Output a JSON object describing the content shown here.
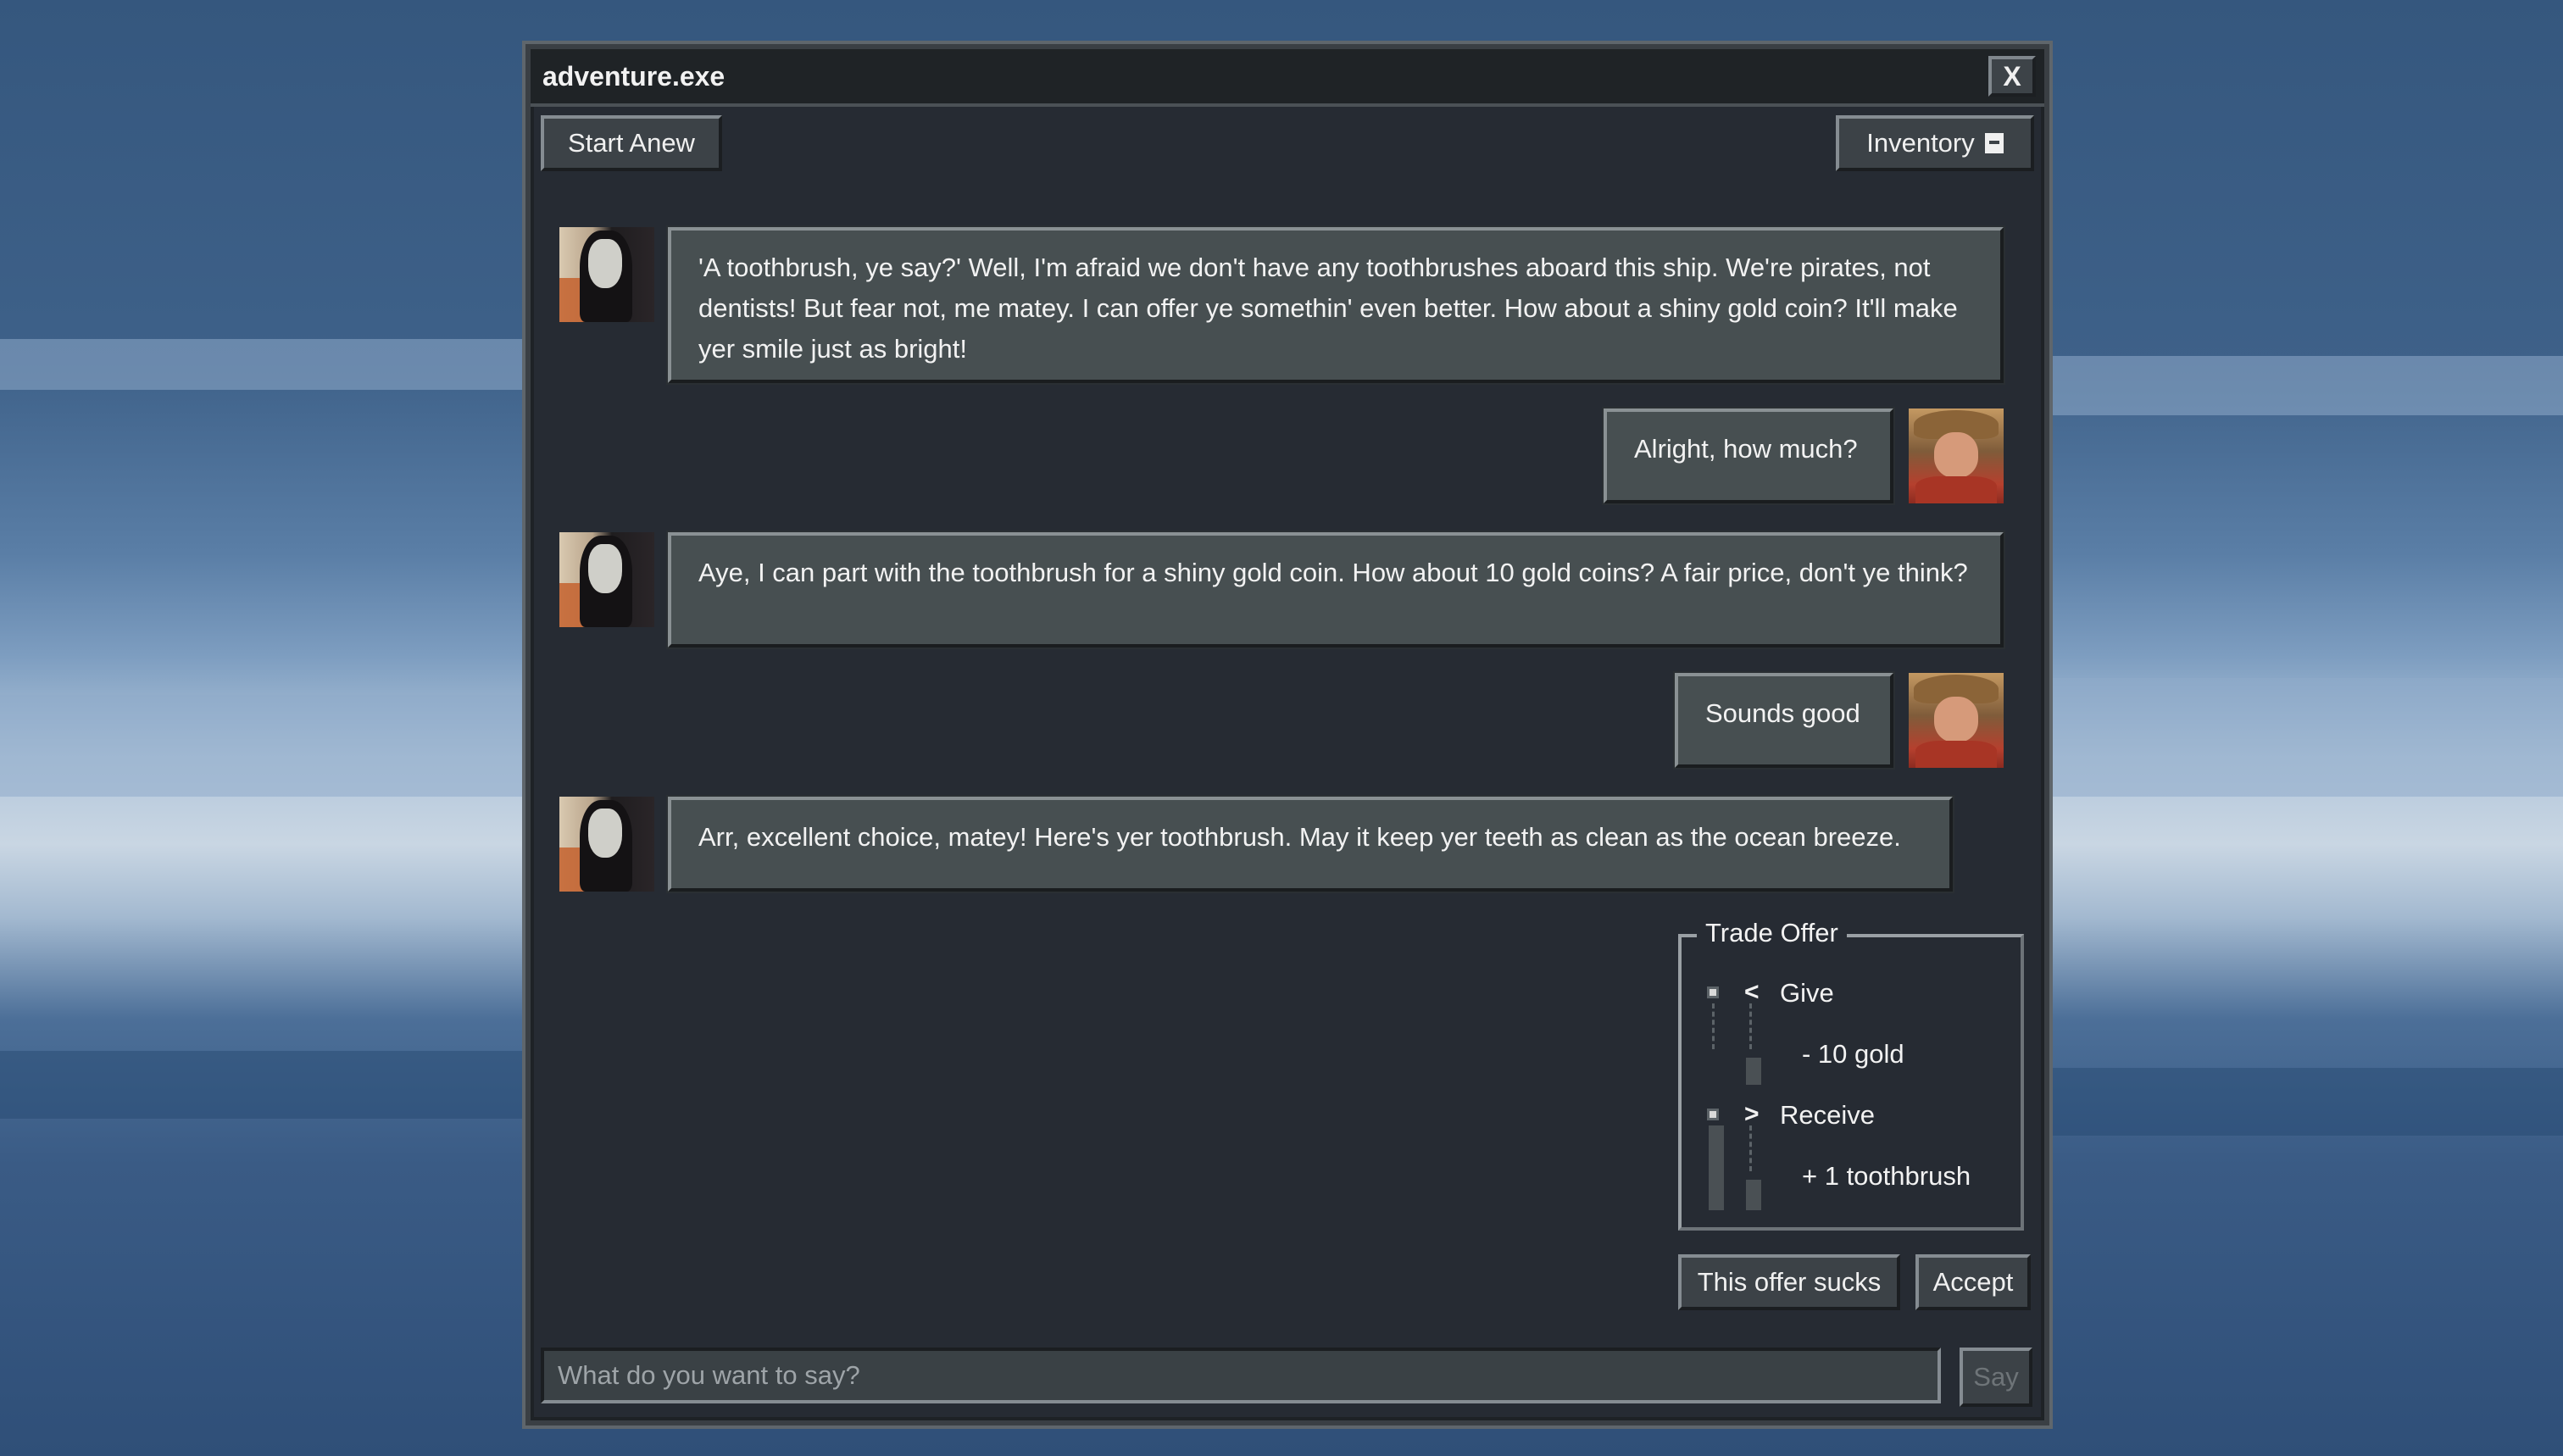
{
  "window": {
    "title": "adventure.exe",
    "close_label": "X"
  },
  "toolbar": {
    "start_label": "Start Anew",
    "inventory_label": "Inventory"
  },
  "messages": [
    {
      "from": "npc",
      "text": "'A toothbrush, ye say?' Well, I'm afraid we don't have any toothbrushes aboard this ship. We're pirates, not dentists! But fear not, me matey. I can offer ye somethin' even better. How about a shiny gold coin? It'll make yer smile just as bright!"
    },
    {
      "from": "user",
      "text": "Alright, how much?"
    },
    {
      "from": "npc",
      "text": "Aye, I can part with the toothbrush for a shiny gold coin. How about 10 gold coins? A fair price, don't ye think?"
    },
    {
      "from": "user",
      "text": "Sounds good"
    },
    {
      "from": "npc",
      "text": "Arr, excellent choice, matey! Here's yer toothbrush. May it keep yer teeth as clean as the ocean breeze."
    }
  ],
  "trade": {
    "legend": "Trade Offer",
    "give": {
      "arrow": "<",
      "label": "Give",
      "item": "- 10 gold"
    },
    "receive": {
      "arrow": ">",
      "label": "Receive",
      "item": "+ 1 toothbrush"
    },
    "reject_label": "This offer sucks",
    "accept_label": "Accept"
  },
  "input": {
    "placeholder": "What do you want to say?",
    "value": ""
  },
  "say_label": "Say",
  "icons": {
    "inventory": "archive-icon",
    "npc_avatar": "pirate-avatar",
    "user_avatar": "player-avatar"
  }
}
